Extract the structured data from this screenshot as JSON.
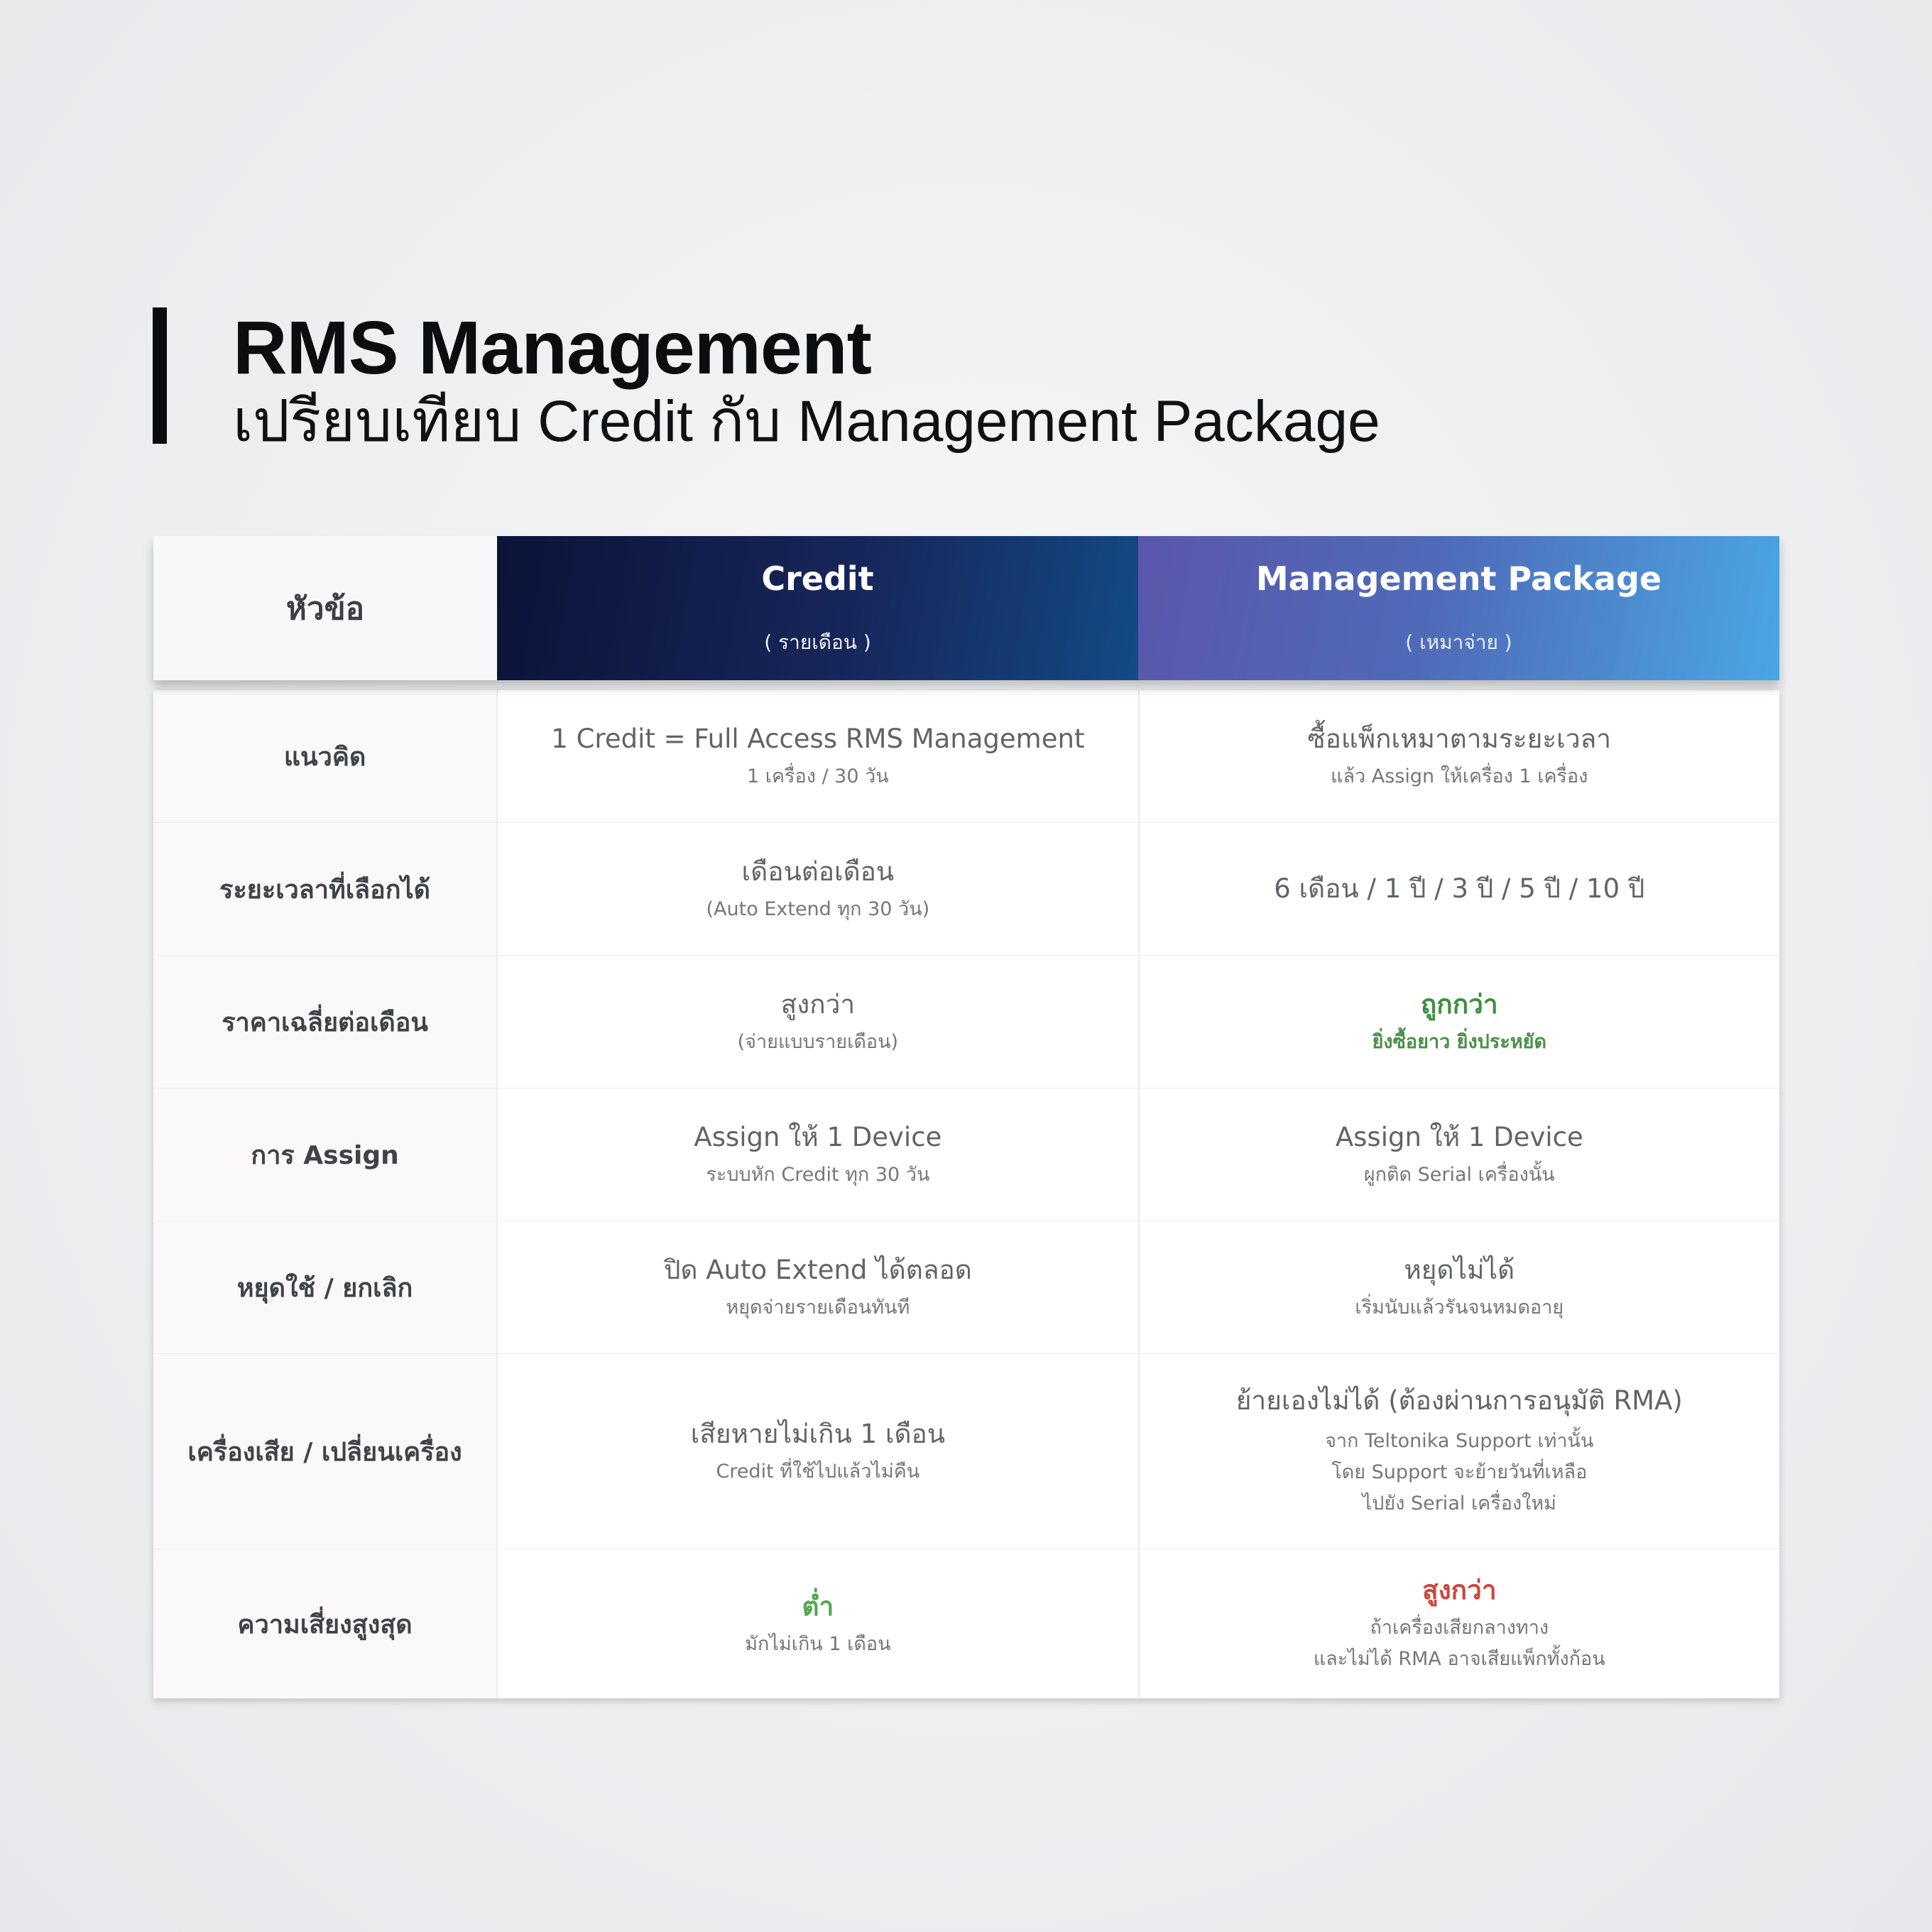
{
  "header": {
    "title": "RMS Management",
    "subtitle": "เปรียบเทียบ Credit กับ Management Package"
  },
  "table": {
    "topic_header": "หัวข้อ",
    "credit": {
      "name": "Credit",
      "sub": "( รายเดือน )"
    },
    "package": {
      "name": "Management Package",
      "sub": "( เหมาจ่าย )"
    },
    "rows": [
      {
        "topic": "แนวคิด",
        "credit_main": "1 Credit = Full Access RMS Management",
        "credit_note": "1 เครื่อง / 30 วัน",
        "package_main": "ซื้อแพ็กเหมาตามระยะเวลา",
        "package_note": "แล้ว Assign ให้เครื่อง 1 เครื่อง"
      },
      {
        "topic": "ระยะเวลาที่เลือกได้",
        "credit_main": "เดือนต่อเดือน",
        "credit_note": "(Auto Extend ทุก 30 วัน)",
        "package_main": "6 เดือน / 1 ปี / 3 ปี / 5 ปี / 10 ปี"
      },
      {
        "topic": "ราคาเฉลี่ยต่อเดือน",
        "credit_main": "สูงกว่า",
        "credit_note": "(จ่ายแบบรายเดือน)",
        "package_main": "ถูกกว่า",
        "package_note": "ยิ่งซื้อยาว ยิ่งประหยัด"
      },
      {
        "topic": "การ Assign",
        "credit_main": "Assign ให้ 1 Device",
        "credit_note": "ระบบหัก Credit ทุก 30 วัน",
        "package_main": "Assign ให้ 1 Device",
        "package_note": "ผูกติด Serial เครื่องนั้น"
      },
      {
        "topic": "หยุดใช้ / ยกเลิก",
        "credit_main": "ปิด Auto Extend ได้ตลอด",
        "credit_note": "หยุดจ่ายรายเดือนทันที",
        "package_main": "หยุดไม่ได้",
        "package_note": "เริ่มนับแล้วรันจนหมดอายุ"
      },
      {
        "topic": "เครื่องเสีย / เปลี่ยนเครื่อง",
        "credit_main": "เสียหายไม่เกิน 1 เดือน",
        "credit_note": "Credit ที่ใช้ไปแล้วไม่คืน",
        "package_main": "ย้ายเองไม่ได้ (ต้องผ่านการอนุมัติ RMA)",
        "package_note_lines": [
          "จาก Teltonika Support เท่านั้น",
          "โดย Support จะย้ายวันที่เหลือ",
          "ไปยัง Serial เครื่องใหม่"
        ]
      },
      {
        "topic": "ความเสี่ยงสูงสุด",
        "credit_main": "ต่ำ",
        "credit_note": "มักไม่เกิน 1 เดือน",
        "package_main": "สูงกว่า",
        "package_note_lines": [
          "ถ้าเครื่องเสียกลางทาง",
          "และไม่ได้ RMA อาจเสียแพ็กทั้งก้อน"
        ]
      }
    ]
  },
  "colors": {
    "accent_green": "#3e8f3e",
    "accent_red": "#d0443b",
    "credit_header": "#0b1438",
    "package_header": "#4aa6e2"
  }
}
